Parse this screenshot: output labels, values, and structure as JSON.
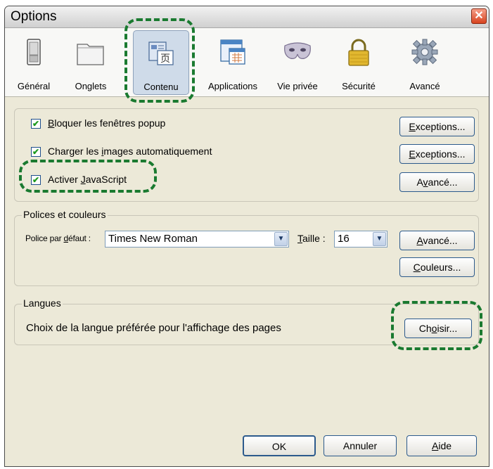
{
  "window": {
    "title": "Options",
    "close_icon": "close-icon"
  },
  "tabs": [
    {
      "label": "Général",
      "icon": "switch-icon"
    },
    {
      "label": "Onglets",
      "icon": "folder-tabs-icon"
    },
    {
      "label": "Contenu",
      "icon": "content-icon",
      "selected": true
    },
    {
      "label": "Applications",
      "icon": "applications-icon"
    },
    {
      "label": "Vie privée",
      "icon": "mask-icon"
    },
    {
      "label": "Sécurité",
      "icon": "padlock-icon"
    },
    {
      "label": "Avancé",
      "icon": "gear-icon"
    }
  ],
  "content": {
    "popup": {
      "pre": "",
      "accel": "B",
      "post": "loquer les fenêtres popup",
      "checked": true
    },
    "images": {
      "pre": "Charger les ",
      "accel": "i",
      "post": "mages automatiquement",
      "checked": true
    },
    "javascript": {
      "pre": "Activer ",
      "accel": "J",
      "post": "avaScript",
      "checked": true
    },
    "exceptions1": {
      "pre": "",
      "accel": "E",
      "post": "xceptions..."
    },
    "exceptions2": {
      "pre": "",
      "accel": "E",
      "post": "xceptions..."
    },
    "advanced_js": {
      "pre": "A",
      "accel": "v",
      "post": "ancé..."
    }
  },
  "fonts": {
    "legend": "Polices et couleurs",
    "default_font_label": {
      "pre": "Police par ",
      "accel": "d",
      "post": "éfaut :"
    },
    "default_font_value": "Times New Roman",
    "size_label": {
      "pre": "",
      "accel": "T",
      "post": "aille :"
    },
    "size_value": "16",
    "advanced_btn": {
      "pre": "",
      "accel": "A",
      "post": "vancé..."
    },
    "colors_btn": {
      "pre": "",
      "accel": "C",
      "post": "ouleurs..."
    }
  },
  "languages": {
    "legend": "Langues",
    "description": "Choix de la langue préférée pour l'affichage des pages",
    "choose_btn": {
      "pre": "Ch",
      "accel": "o",
      "post": "isir..."
    }
  },
  "footer": {
    "ok": "OK",
    "cancel": "Annuler",
    "help": {
      "pre": "",
      "accel": "A",
      "post": "ide"
    }
  },
  "colors": {
    "highlight_dash": "#1a7a30",
    "selected_tab": "#cfdbe9"
  }
}
